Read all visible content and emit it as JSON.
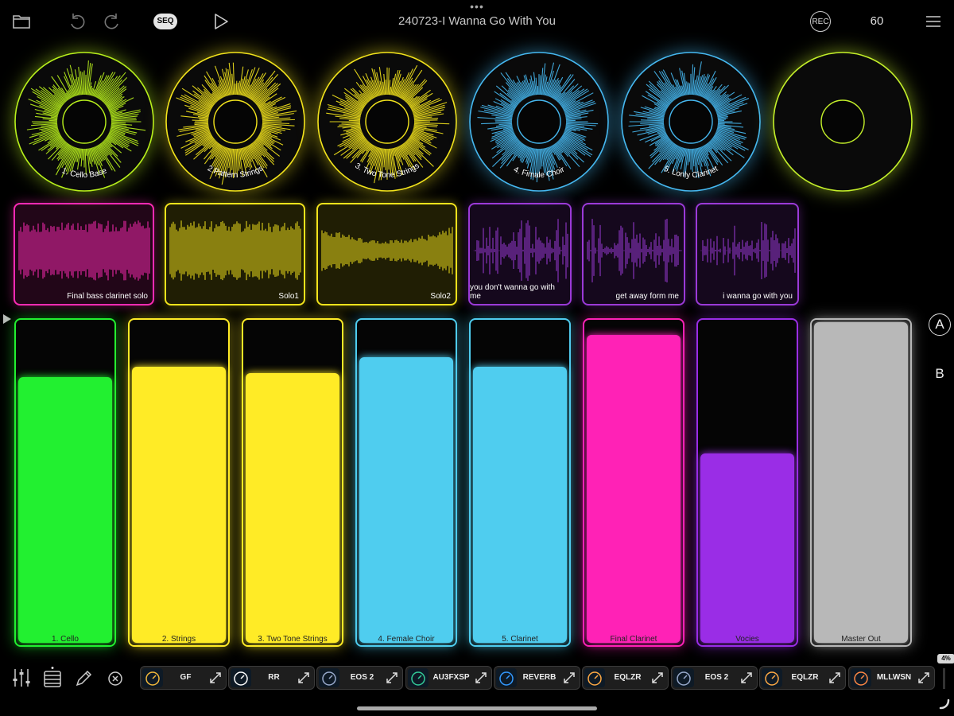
{
  "header": {
    "title": "240723-I Wanna Go With You",
    "dots": "•••",
    "seq_label": "SEQ",
    "rec_label": "REC",
    "tempo": "60"
  },
  "rings": [
    {
      "label": "1. Cello Base",
      "color": "#b8f01c",
      "has_audio": true
    },
    {
      "label": "2.Pattern Strings",
      "color": "#f2e31c",
      "has_audio": true
    },
    {
      "label": "3. Two Tone Strings",
      "color": "#f2e31c",
      "has_audio": true
    },
    {
      "label": "4. Fimale Choir",
      "color": "#46b8f0",
      "has_audio": true
    },
    {
      "label": "5. Lonly Clarinet",
      "color": "#46b8f0",
      "has_audio": true
    },
    {
      "label": "",
      "color": "#c4f02a",
      "has_audio": false
    }
  ],
  "clips": [
    {
      "label": "Final bass clarinet solo",
      "color": "#ff2ab4"
    },
    {
      "label": "Solo1",
      "color": "#f2e31c"
    },
    {
      "label": "Solo2",
      "color": "#f2e31c"
    },
    {
      "label": "you don't wanna go with me",
      "color": "#9b3ad8"
    },
    {
      "label": "get away form me",
      "color": "#9b3ad8"
    },
    {
      "label": "i wanna go with you",
      "color": "#9b3ad8"
    }
  ],
  "faders": [
    {
      "label": "1. Cello",
      "color": "#22f030",
      "level": 0.83
    },
    {
      "label": "2. Strings",
      "color": "#ffeb26",
      "level": 0.86
    },
    {
      "label": "3. Two Tone Strings",
      "color": "#ffeb26",
      "level": 0.84
    },
    {
      "label": "4. Female Choir",
      "color": "#4fcdef",
      "level": 0.89
    },
    {
      "label": "5. Clarinet",
      "color": "#4fcdef",
      "level": 0.86
    },
    {
      "label": "Final Clarinet",
      "color": "#ff22b6",
      "level": 0.96
    },
    {
      "label": "Vocies",
      "color": "#9a2de6",
      "level": 0.59
    },
    {
      "label": "Master Out",
      "color": "#b8b8b8",
      "level": 1.0
    }
  ],
  "scenes": {
    "a": "A",
    "b": "B"
  },
  "plugins": [
    {
      "label": "GF",
      "icon": "gauge-icon"
    },
    {
      "label": "RR",
      "icon": "r-logo-icon"
    },
    {
      "label": "EOS 2",
      "icon": "eos-a-icon"
    },
    {
      "label": "AU3FXSP",
      "icon": "wave-stack-icon"
    },
    {
      "label": "REVERB",
      "icon": "reverb-icon"
    },
    {
      "label": "EQLZR",
      "icon": "eq-a-icon"
    },
    {
      "label": "EOS 2",
      "icon": "eos-b-icon"
    },
    {
      "label": "EQLZR",
      "icon": "eq-b-icon"
    },
    {
      "label": "MLLWSN",
      "icon": "keyboard-icon"
    }
  ],
  "cpu": "4%",
  "colors": {
    "clip_purple": "#9b3ad8",
    "clip_pink": "#ff2ab4"
  }
}
